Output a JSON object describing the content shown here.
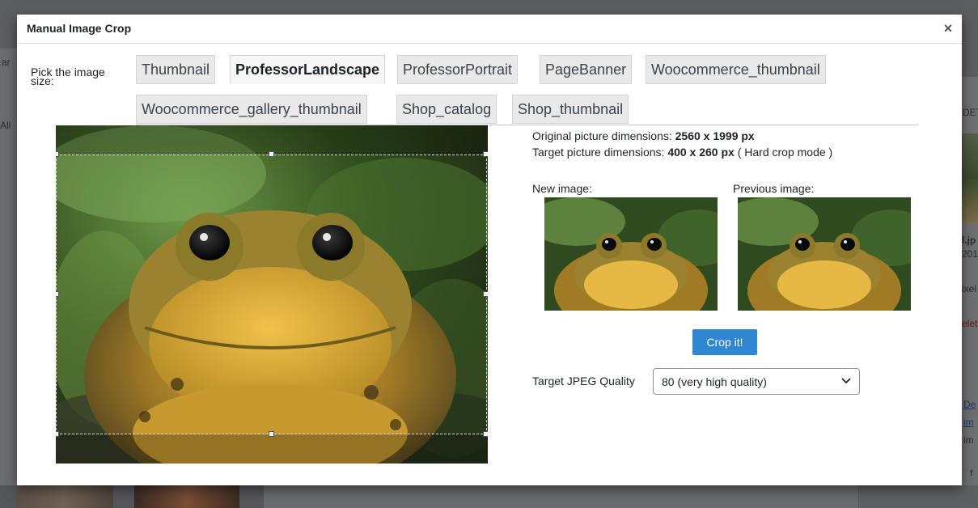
{
  "background": {
    "left_fragments": [
      "ar",
      "All"
    ],
    "right_fragments": [
      "DET",
      "l.jp",
      "201",
      "ixel",
      "elet",
      "De",
      "im",
      "im",
      "f"
    ]
  },
  "modal": {
    "title": "Manual Image Crop",
    "close_symbol": "×"
  },
  "size_picker": {
    "label": "Pick the image size:",
    "tabs": [
      {
        "label": "Thumbnail",
        "active": false
      },
      {
        "label": "ProfessorLandscape",
        "active": true
      },
      {
        "label": "ProfessorPortrait",
        "active": false
      },
      {
        "label": "PageBanner",
        "active": false
      },
      {
        "label": "Woocommerce_thumbnail",
        "active": false
      },
      {
        "label": "Woocommerce_gallery_thumbnail",
        "active": false
      },
      {
        "label": "Shop_catalog",
        "active": false
      },
      {
        "label": "Shop_thumbnail",
        "active": false
      }
    ]
  },
  "dimensions": {
    "original_prefix": "Original picture dimensions:",
    "original_value": "2560 x 1999 px",
    "target_prefix": "Target picture dimensions:",
    "target_value": "400 x 260 px",
    "target_suffix": "( Hard crop mode )"
  },
  "previews": {
    "new_label": "New image:",
    "previous_label": "Previous image:"
  },
  "crop_button_label": "Crop it!",
  "quality": {
    "label": "Target JPEG Quality",
    "selected": "80 (very high quality)"
  },
  "colors": {
    "accent_button": "#2f86d1",
    "tab_background": "#e9e9e9",
    "modal_background": "#ffffff"
  },
  "icons": {
    "close": "close-icon",
    "dropdown": "chevron-down-icon"
  }
}
